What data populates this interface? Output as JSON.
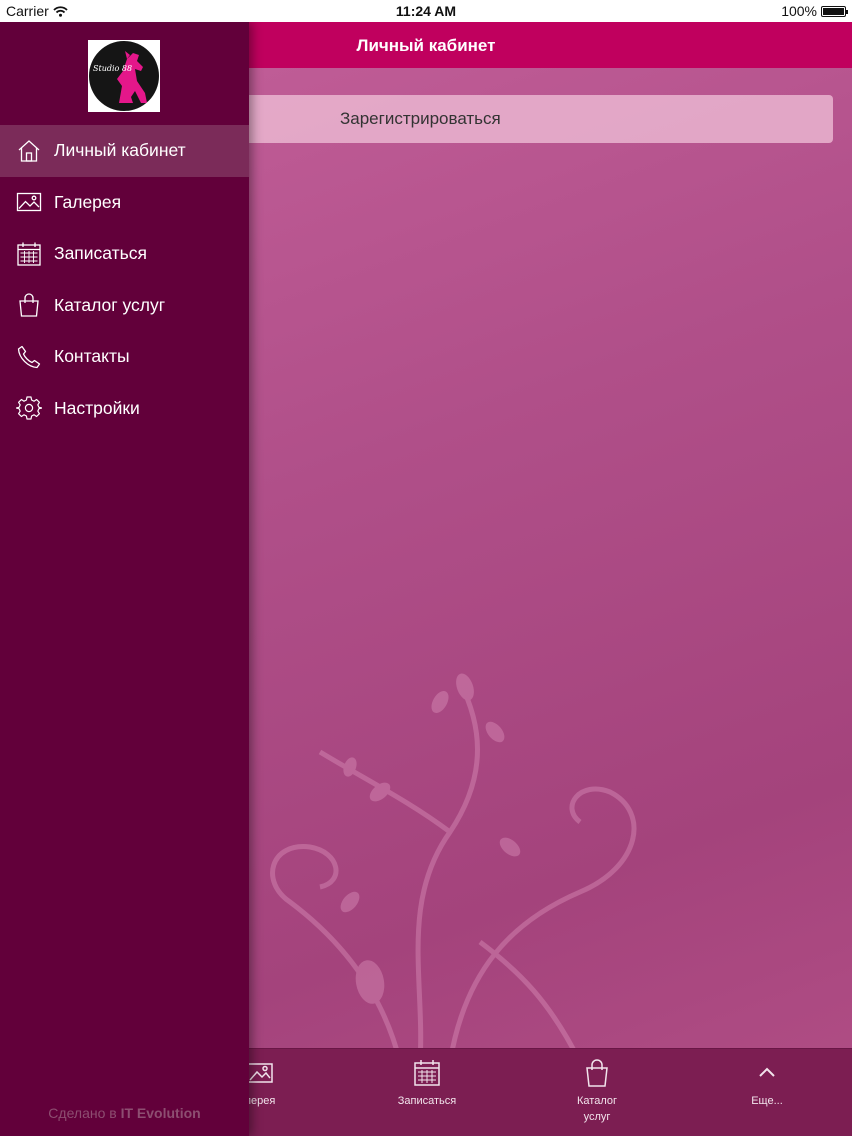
{
  "status_bar": {
    "carrier": "Carrier",
    "time": "11:24 AM",
    "battery": "100%",
    "battery_level": 1.0
  },
  "navbar": {
    "title": "Личный кабинет"
  },
  "main": {
    "register_label": "Зарегистрироваться"
  },
  "drawer": {
    "logo_text": "Studio 88",
    "items": [
      {
        "label": "Личный кабинет",
        "icon": "home-icon",
        "active": true
      },
      {
        "label": "Галерея",
        "icon": "image-icon",
        "active": false
      },
      {
        "label": "Записаться",
        "icon": "calendar-icon",
        "active": false
      },
      {
        "label": "Каталог услуг",
        "icon": "shopping-bag-icon",
        "active": false
      },
      {
        "label": "Контакты",
        "icon": "phone-icon",
        "active": false
      },
      {
        "label": "Настройки",
        "icon": "gear-icon",
        "active": false
      }
    ],
    "credit_prefix": "Сделано в",
    "credit_brand": "IT Evolution"
  },
  "tabbar": {
    "items": [
      {
        "label": "лерея",
        "icon": "image-icon"
      },
      {
        "label": "Записаться",
        "icon": "calendar-icon"
      },
      {
        "label": "Каталог услуг",
        "icon": "shopping-bag-icon"
      },
      {
        "label": "Еще...",
        "icon": "chevron-up-icon"
      }
    ]
  },
  "colors": {
    "accent": "#c0005e",
    "drawer": "#62003a",
    "drawer_active": "#7b2b59",
    "tabbar": "#7c1e52"
  }
}
